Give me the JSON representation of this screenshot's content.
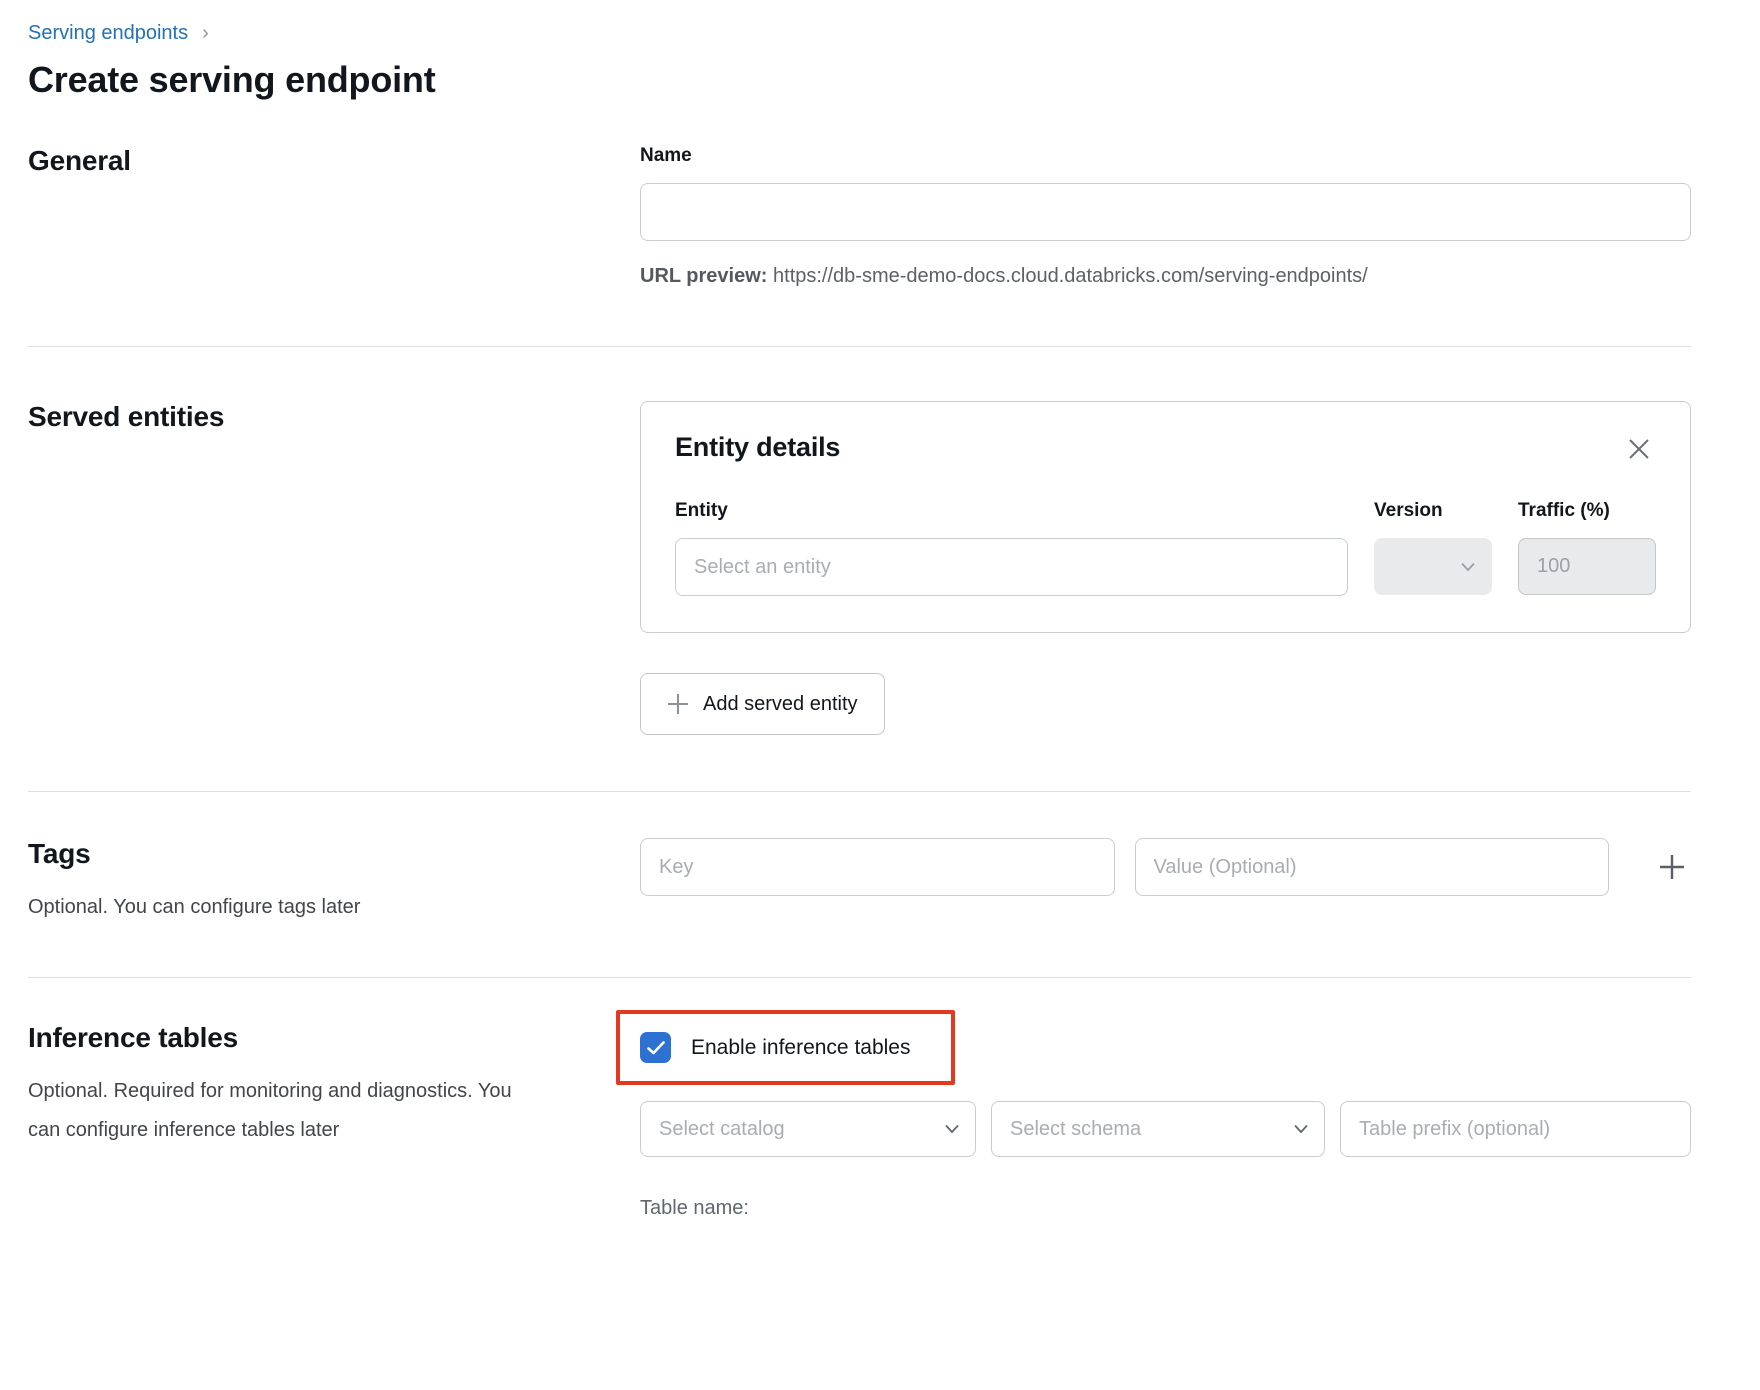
{
  "breadcrumb": {
    "link_label": "Serving endpoints",
    "separator": "›"
  },
  "page_title": "Create serving endpoint",
  "general": {
    "heading": "General",
    "name_label": "Name",
    "name_value": "",
    "url_preview_label": "URL preview:",
    "url_preview_value": "https://db-sme-demo-docs.cloud.databricks.com/serving-endpoints/"
  },
  "served_entities": {
    "heading": "Served entities",
    "card_title": "Entity details",
    "entity_label": "Entity",
    "entity_placeholder": "Select an entity",
    "version_label": "Version",
    "traffic_label": "Traffic (%)",
    "traffic_value": "100",
    "add_button_label": "Add served entity"
  },
  "tags": {
    "heading": "Tags",
    "subtitle": "Optional. You can configure tags later",
    "key_placeholder": "Key",
    "value_placeholder": "Value (Optional)"
  },
  "inference_tables": {
    "heading": "Inference tables",
    "subtitle": "Optional. Required for monitoring and diagnostics. You can configure inference tables later",
    "checkbox_label": "Enable inference tables",
    "checkbox_checked": "true",
    "catalog_placeholder": "Select catalog",
    "schema_placeholder": "Select schema",
    "prefix_placeholder": "Table prefix (optional)",
    "table_name_label": "Table name:"
  },
  "colors": {
    "link_blue": "#2272b4",
    "checkbox_blue": "#2d72d2",
    "highlight_red": "#e2391f",
    "border_gray": "#c9cdd0",
    "disabled_bg": "#e9eaeb"
  }
}
